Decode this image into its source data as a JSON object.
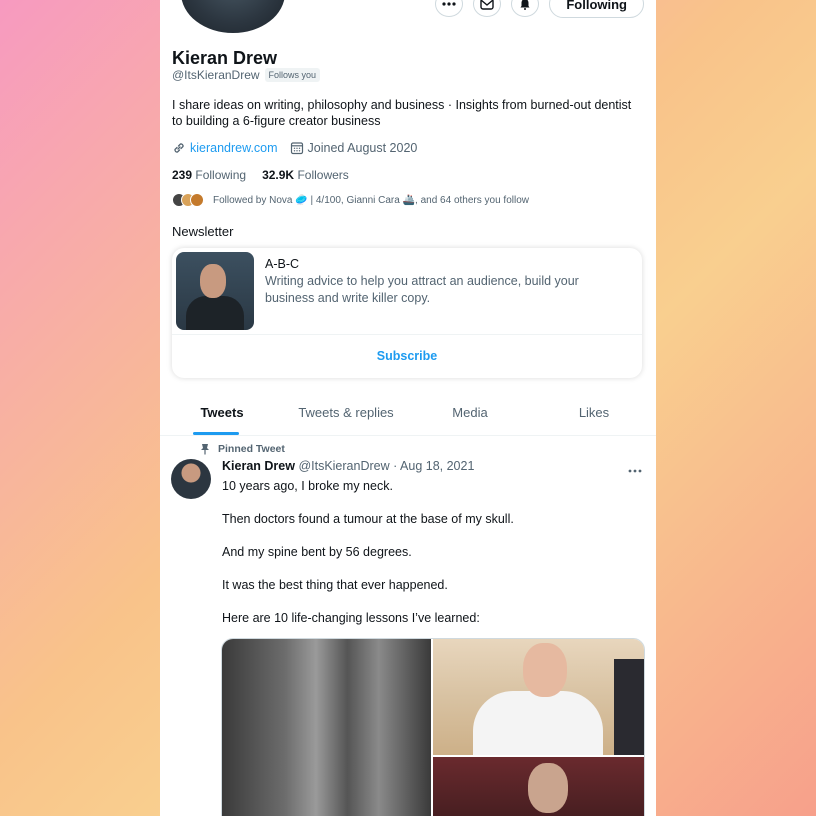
{
  "profile": {
    "name": "Kieran Drew",
    "handle": "@ItsKieranDrew",
    "follows_you": "Follows you",
    "bio": "I share ideas on writing, philosophy and business · Insights from burned-out dentist to building a 6-figure creator business",
    "website": "kierandrew.com",
    "joined": "Joined August 2020",
    "following_count": "239",
    "following_label": "Following",
    "followers_count": "32.9K",
    "followers_label": "Followers",
    "followed_by": "Followed by Nova 🥏 | 4/100, Gianni Cara 🚢, and 64 others you follow"
  },
  "actions": {
    "following_label": "Following",
    "icons": [
      "more-icon",
      "message-icon",
      "notification-icon"
    ]
  },
  "newsletter": {
    "section_title": "Newsletter",
    "title": "A-B-C",
    "description": "Writing advice to help you attract an audience, build your business and write killer copy.",
    "subscribe_label": "Subscribe"
  },
  "tabs": [
    {
      "label": "Tweets",
      "active": true
    },
    {
      "label": "Tweets & replies",
      "active": false
    },
    {
      "label": "Media",
      "active": false
    },
    {
      "label": "Likes",
      "active": false
    }
  ],
  "tweet": {
    "pinned_label": "Pinned Tweet",
    "author": "Kieran Drew",
    "handle_date": "@ItsKieranDrew · Aug 18, 2021",
    "paragraphs": [
      "10 years ago, I broke my neck.",
      "Then doctors found a tumour at the base of my skull.",
      "And my spine bent by 56 degrees.",
      "It was the best thing that ever happened.",
      "Here are 10 life-changing lessons I’ve learned:"
    ]
  },
  "colors": {
    "accent": "#1d9bf0",
    "text_primary": "#0f1419",
    "text_secondary": "#536471"
  }
}
